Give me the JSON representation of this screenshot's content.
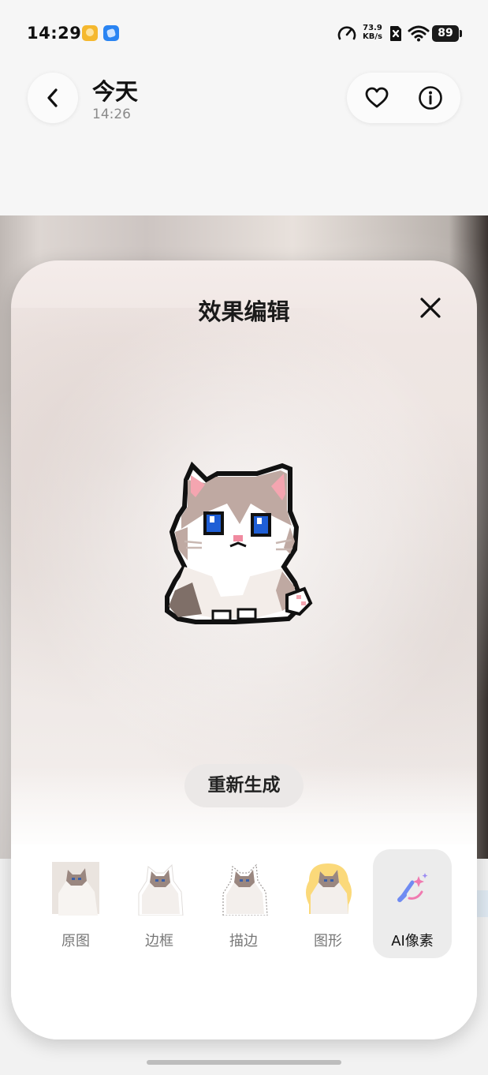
{
  "status_bar": {
    "time": "14:29",
    "net_speed_value": "73.9",
    "net_speed_unit": "KB/s",
    "battery": "89",
    "icons": [
      "app-notification-yellow-icon",
      "app-notification-blue-icon",
      "speed-gauge-icon",
      "sim-off-icon",
      "wifi-icon",
      "battery-icon"
    ]
  },
  "header": {
    "title": "今天",
    "subtitle": "14:26",
    "icons": [
      "back-arrow-icon",
      "heart-icon",
      "info-icon"
    ]
  },
  "sheet": {
    "title": "效果编辑",
    "regenerate_label": "重新生成",
    "options": [
      {
        "label": "原图",
        "selected": false
      },
      {
        "label": "边框",
        "selected": false
      },
      {
        "label": "描边",
        "selected": false
      },
      {
        "label": "图形",
        "selected": false
      },
      {
        "label": "AI像素",
        "selected": true
      }
    ],
    "icons": [
      "close-icon",
      "ai-brush-icon"
    ]
  },
  "colors": {
    "accent": "#6f8bf2",
    "shape_bg": "#fbd97a",
    "panel_bg": "#ffffff",
    "selected_option_bg": "#ececec"
  }
}
